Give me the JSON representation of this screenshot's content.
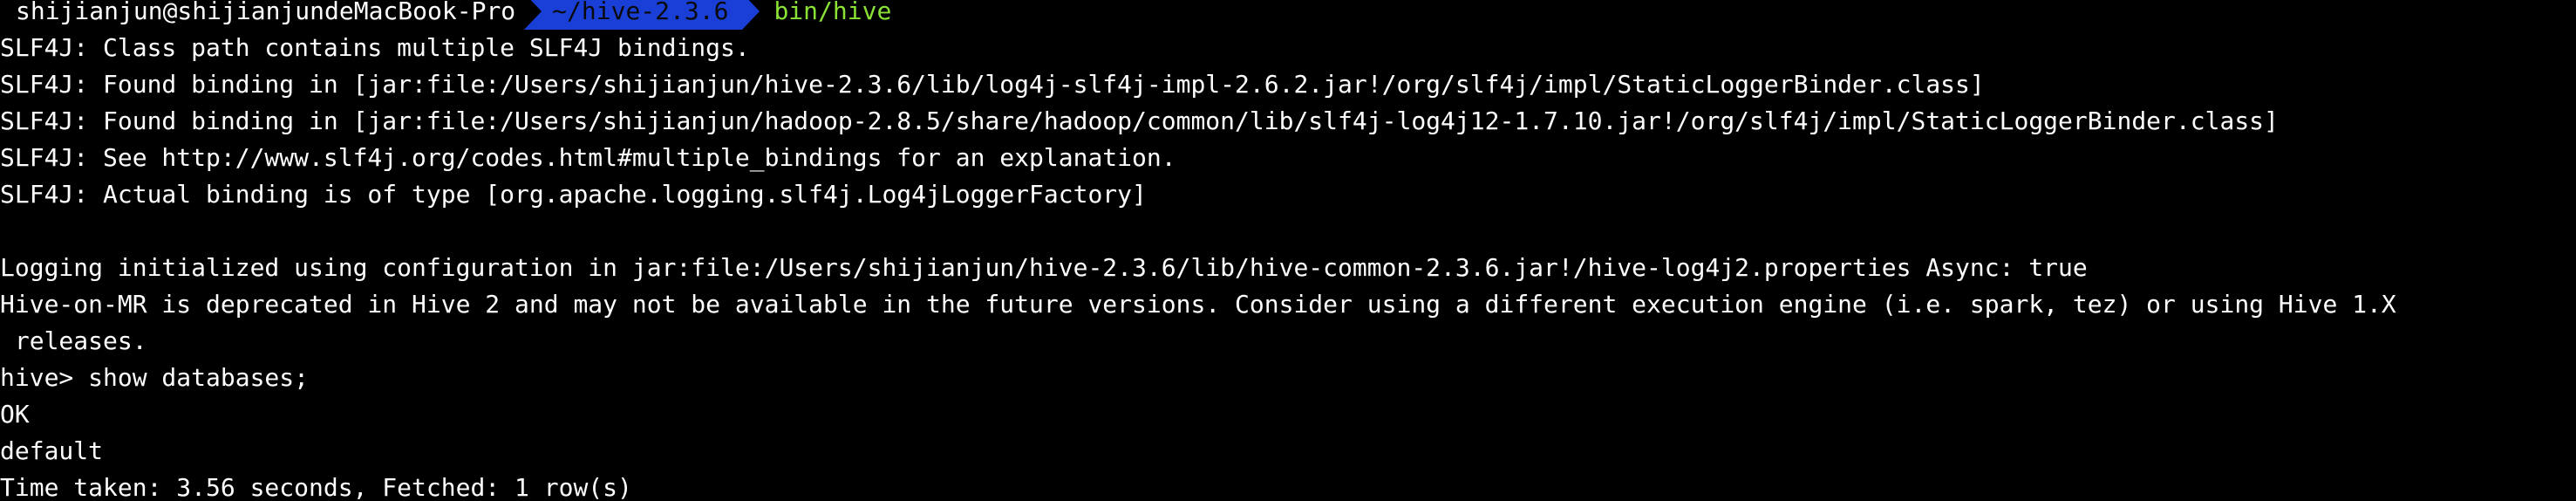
{
  "prompt": {
    "user_host": "shijianjun@shijianjundeMacBook-Pro",
    "directory": "~/hive-2.3.6",
    "command": "bin/hive",
    "colors": {
      "directory_bg": "#1a3fd6",
      "command_fg": "#8ae234",
      "text_fg": "#ffffff",
      "background": "#000000"
    }
  },
  "output": [
    "SLF4J: Class path contains multiple SLF4J bindings.",
    "SLF4J: Found binding in [jar:file:/Users/shijianjun/hive-2.3.6/lib/log4j-slf4j-impl-2.6.2.jar!/org/slf4j/impl/StaticLoggerBinder.class]",
    "SLF4J: Found binding in [jar:file:/Users/shijianjun/hadoop-2.8.5/share/hadoop/common/lib/slf4j-log4j12-1.7.10.jar!/org/slf4j/impl/StaticLoggerBinder.class]",
    "SLF4J: See http://www.slf4j.org/codes.html#multiple_bindings for an explanation.",
    "SLF4J: Actual binding is of type [org.apache.logging.slf4j.Log4jLoggerFactory]",
    "",
    "Logging initialized using configuration in jar:file:/Users/shijianjun/hive-2.3.6/lib/hive-common-2.3.6.jar!/hive-log4j2.properties Async: true",
    "Hive-on-MR is deprecated in Hive 2 and may not be available in the future versions. Consider using a different execution engine (i.e. spark, tez) or using Hive 1.X",
    " releases.",
    "hive> show databases;",
    "OK",
    "default",
    "Time taken: 3.56 seconds, Fetched: 1 row(s)"
  ]
}
